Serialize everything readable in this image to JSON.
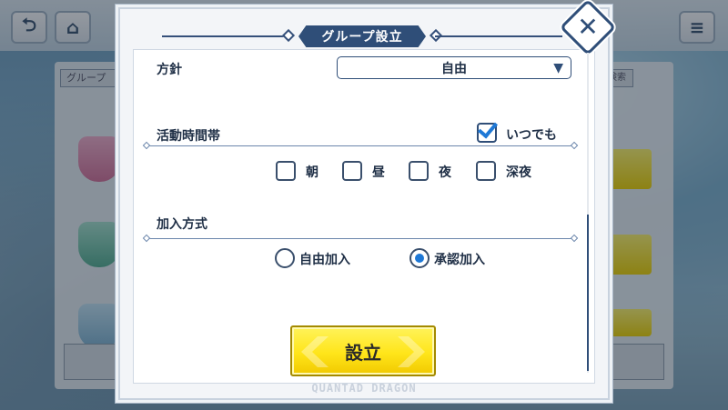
{
  "modal": {
    "title": "グループ設立",
    "close_icon": "close-x-icon"
  },
  "policy": {
    "label": "方針",
    "selected": "自由",
    "chevron_icon": "chevron-down-icon"
  },
  "activity": {
    "label": "活動時間帯",
    "anytime_label": "いつでも",
    "anytime_checked": true,
    "options": [
      {
        "label": "朝",
        "checked": false
      },
      {
        "label": "昼",
        "checked": false
      },
      {
        "label": "夜",
        "checked": false
      },
      {
        "label": "深夜",
        "checked": false
      }
    ]
  },
  "join": {
    "label": "加入方式",
    "options": [
      {
        "label": "自由加入",
        "selected": false
      },
      {
        "label": "承認加入",
        "selected": true
      }
    ]
  },
  "submit_label": "設立",
  "footer_logo": "QUANTAD DRAGON",
  "background": {
    "back_icon": "back-arrow-icon",
    "home_icon": "home-icon",
    "menu_icon": "menu-icon",
    "search_field": "グループ"
  },
  "colors": {
    "accent": "#2f4e78",
    "check": "#1e78d6",
    "button": "#ffe51a"
  }
}
